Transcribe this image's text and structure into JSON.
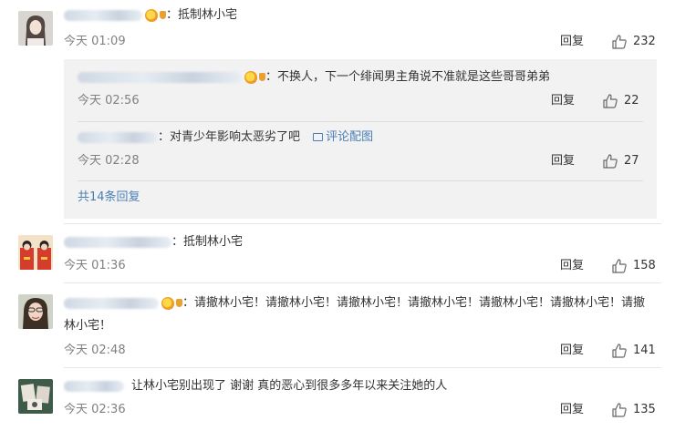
{
  "comments": [
    {
      "text": "：抵制林小宅",
      "time": "今天 01:09",
      "reply": "回复",
      "likes": "232",
      "subreplies": [
        {
          "text": "：不换人，下一个绯闻男主角说不准就是这些哥哥弟弟",
          "time": "今天 02:56",
          "reply": "回复",
          "likes": "22"
        },
        {
          "text": "：对青少年影响太恶劣了吧",
          "pic_link": "评论配图",
          "time": "今天 02:28",
          "reply": "回复",
          "likes": "27"
        }
      ],
      "more_replies": "共14条回复"
    },
    {
      "text": "：抵制林小宅",
      "time": "今天 01:36",
      "reply": "回复",
      "likes": "158"
    },
    {
      "text": "：请撤林小宅！请撤林小宅！请撤林小宅！请撤林小宅！请撤林小宅！请撤林小宅！请撤林小宅！",
      "time": "今天 02:48",
      "reply": "回复",
      "likes": "141"
    },
    {
      "text": "让林小宅别出现了 谢谢 真的恶心到很多多年以来关注她的人",
      "time": "今天 02:36",
      "reply": "回复",
      "likes": "135"
    }
  ],
  "icons": {
    "like": "thumbs-up-icon",
    "verified": "verified-badge-icon",
    "image": "image-icon"
  },
  "colors": {
    "link": "#4a7fb5",
    "time": "#808080",
    "sub_box": "#f2f2f2"
  }
}
